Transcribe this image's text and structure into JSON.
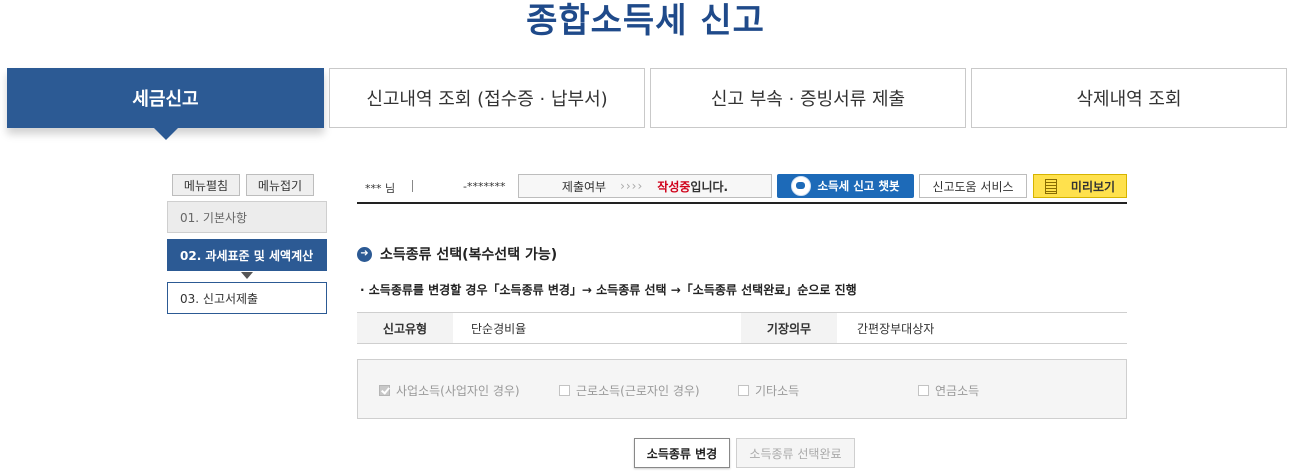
{
  "page_title": "종합소득세 신고",
  "tabs": [
    {
      "label": "세금신고",
      "active": true
    },
    {
      "label": "신고내역 조회 (접수증 · 납부서)",
      "active": false
    },
    {
      "label": "신고 부속 · 증빙서류 제출",
      "active": false
    },
    {
      "label": "삭제내역 조회",
      "active": false
    }
  ],
  "sidebar": {
    "expand_label": "메뉴펼침",
    "collapse_label": "메뉴접기",
    "steps": [
      {
        "label": "01. 기본사항",
        "state": "done"
      },
      {
        "label": "02. 과세표준 및 세액계산",
        "state": "current"
      },
      {
        "label": "03. 신고서제출",
        "state": "next"
      }
    ]
  },
  "header": {
    "user_name": "*** 님",
    "user_id": "-*******",
    "status_label": "제출여부",
    "status_arrows": "››››",
    "status_value": "작성중",
    "status_suffix": "입니다.",
    "chatbot_label": "소득세 신고 챗봇",
    "help_label": "신고도움 서비스",
    "preview_label": "미리보기"
  },
  "section": {
    "title": "소득종류 선택(복수선택 가능)",
    "note": "· 소득종류를 변경할 경우「소득종류 변경」→ 소득종류 선택 →「소득종류 선택완료」순으로 진행"
  },
  "info_table": {
    "type_header": "신고유형",
    "type_value": "단순경비율",
    "duty_header": "기장의무",
    "duty_value": "간편장부대상자"
  },
  "income_types": [
    {
      "label": "사업소득(사업자인 경우)",
      "checked": true
    },
    {
      "label": "근로소득(근로자인 경우)",
      "checked": false
    },
    {
      "label": "기타소득",
      "checked": false
    },
    {
      "label": "연금소득",
      "checked": false
    }
  ],
  "buttons": {
    "change_label": "소득종류 변경",
    "complete_label": "소득종류 선택완료"
  },
  "colors": {
    "brand_blue": "#2c5a94",
    "title_blue": "#1f4a8a",
    "status_red": "#d0021b",
    "preview_yellow": "#ffe14d"
  }
}
